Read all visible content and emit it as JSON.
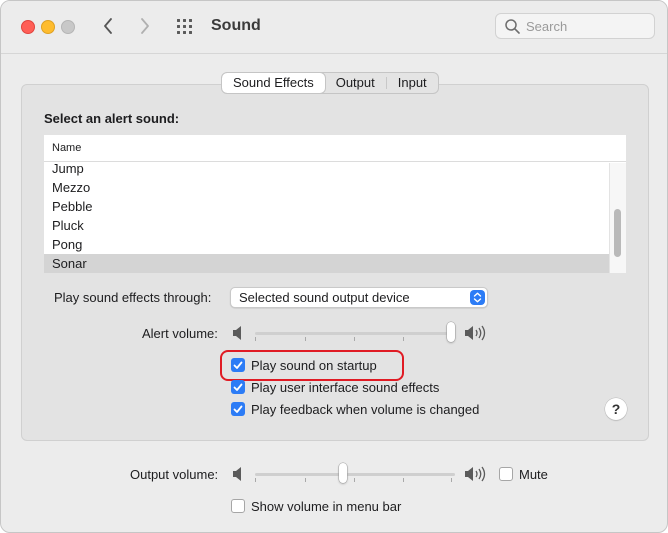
{
  "window": {
    "title": "Sound",
    "search_placeholder": "Search"
  },
  "tabs": [
    "Sound Effects",
    "Output",
    "Input"
  ],
  "active_tab": "Sound Effects",
  "alert_section": {
    "label": "Select an alert sound:",
    "column_header": "Name",
    "sounds": [
      "Jump",
      "Mezzo",
      "Pebble",
      "Pluck",
      "Pong",
      "Sonar"
    ],
    "selected": "Sonar"
  },
  "effects_through": {
    "label": "Play sound effects through:",
    "value": "Selected sound output device"
  },
  "alert_volume": {
    "label": "Alert volume:",
    "level": 1.0
  },
  "checkboxes": {
    "startup": {
      "label": "Play sound on startup",
      "checked": true
    },
    "ui_effects": {
      "label": "Play user interface sound effects",
      "checked": true
    },
    "feedback": {
      "label": "Play feedback when volume is changed",
      "checked": true
    }
  },
  "help_label": "?",
  "output_volume": {
    "label": "Output volume:",
    "level": 0.44,
    "mute_label": "Mute",
    "muted": false
  },
  "menu_bar": {
    "label": "Show volume in menu bar",
    "checked": false
  },
  "colors": {
    "accent": "#2c7cf6",
    "highlight_outline": "#e01b24",
    "close": "#ff5f57",
    "minimize": "#febc2e"
  }
}
